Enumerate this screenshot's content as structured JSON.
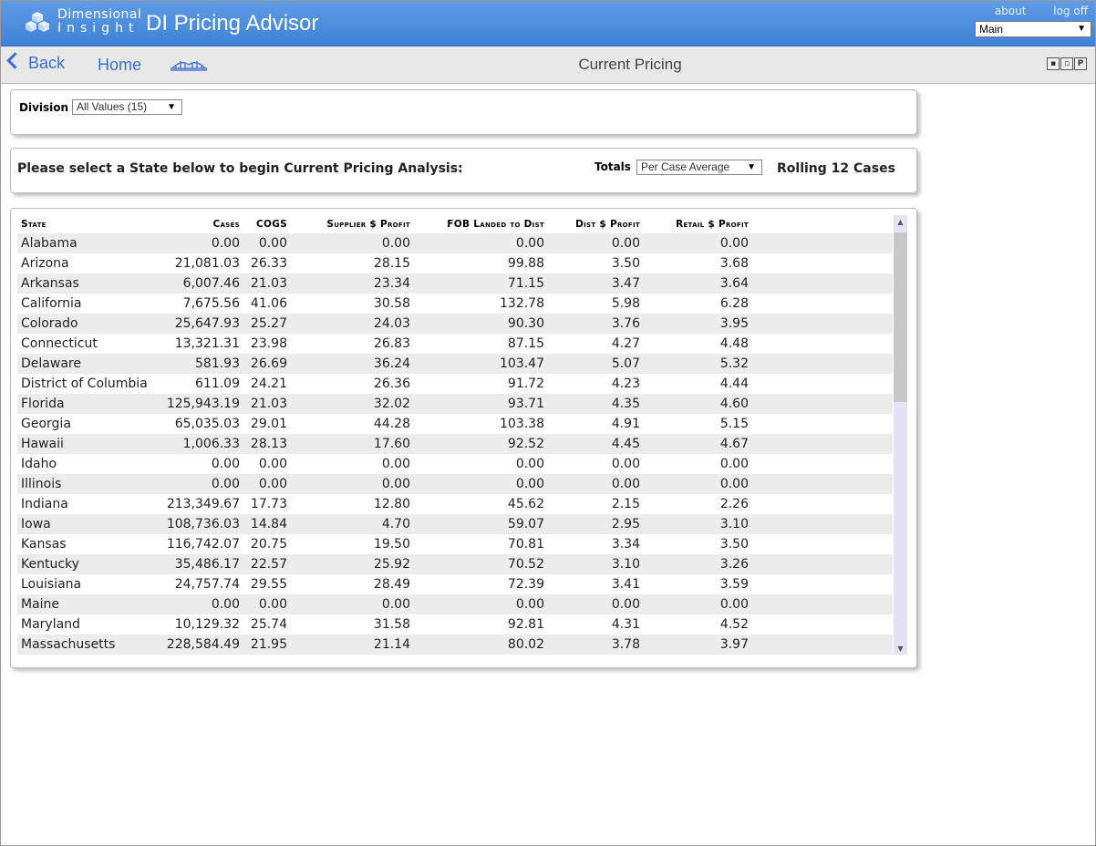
{
  "header": {
    "logo_line1": "Dimensional",
    "logo_line2": "Insight",
    "app_title": "DI Pricing Advisor",
    "about_link": "about",
    "logoff_link": "log off",
    "view_select": "Main"
  },
  "nav": {
    "back_label": "Back",
    "home_label": "Home",
    "page_title": "Current Pricing",
    "icons": [
      "print-icon",
      "export-icon",
      "pdf-icon"
    ],
    "pdf_glyph": "P"
  },
  "filters": {
    "division_label": "Division",
    "division_value": "All Values (15)",
    "prompt": "Please select a State below to begin Current Pricing Analysis:",
    "totals_label": "Totals",
    "totals_value": "Per Case Average",
    "rolling_label": "Rolling 12 Cases"
  },
  "table": {
    "columns": [
      "State",
      "Cases",
      "COGS",
      "Supplier $ Profit",
      "FOB Landed to Dist",
      "Dist $ Profit",
      "Retail $ Profit"
    ],
    "rows": [
      [
        "Alabama",
        "0.00",
        "0.00",
        "0.00",
        "0.00",
        "0.00",
        "0.00"
      ],
      [
        "Arizona",
        "21,081.03",
        "26.33",
        "28.15",
        "99.88",
        "3.50",
        "3.68"
      ],
      [
        "Arkansas",
        "6,007.46",
        "21.03",
        "23.34",
        "71.15",
        "3.47",
        "3.64"
      ],
      [
        "California",
        "7,675.56",
        "41.06",
        "30.58",
        "132.78",
        "5.98",
        "6.28"
      ],
      [
        "Colorado",
        "25,647.93",
        "25.27",
        "24.03",
        "90.30",
        "3.76",
        "3.95"
      ],
      [
        "Connecticut",
        "13,321.31",
        "23.98",
        "26.83",
        "87.15",
        "4.27",
        "4.48"
      ],
      [
        "Delaware",
        "581.93",
        "26.69",
        "36.24",
        "103.47",
        "5.07",
        "5.32"
      ],
      [
        "District of Columbia",
        "611.09",
        "24.21",
        "26.36",
        "91.72",
        "4.23",
        "4.44"
      ],
      [
        "Florida",
        "125,943.19",
        "21.03",
        "32.02",
        "93.71",
        "4.35",
        "4.60"
      ],
      [
        "Georgia",
        "65,035.03",
        "29.01",
        "44.28",
        "103.38",
        "4.91",
        "5.15"
      ],
      [
        "Hawaii",
        "1,006.33",
        "28.13",
        "17.60",
        "92.52",
        "4.45",
        "4.67"
      ],
      [
        "Idaho",
        "0.00",
        "0.00",
        "0.00",
        "0.00",
        "0.00",
        "0.00"
      ],
      [
        "Illinois",
        "0.00",
        "0.00",
        "0.00",
        "0.00",
        "0.00",
        "0.00"
      ],
      [
        "Indiana",
        "213,349.67",
        "17.73",
        "12.80",
        "45.62",
        "2.15",
        "2.26"
      ],
      [
        "Iowa",
        "108,736.03",
        "14.84",
        "4.70",
        "59.07",
        "2.95",
        "3.10"
      ],
      [
        "Kansas",
        "116,742.07",
        "20.75",
        "19.50",
        "70.81",
        "3.34",
        "3.50"
      ],
      [
        "Kentucky",
        "35,486.17",
        "22.57",
        "25.92",
        "70.52",
        "3.10",
        "3.26"
      ],
      [
        "Louisiana",
        "24,757.74",
        "29.55",
        "28.49",
        "72.39",
        "3.41",
        "3.59"
      ],
      [
        "Maine",
        "0.00",
        "0.00",
        "0.00",
        "0.00",
        "0.00",
        "0.00"
      ],
      [
        "Maryland",
        "10,129.32",
        "25.74",
        "31.58",
        "92.81",
        "4.31",
        "4.52"
      ],
      [
        "Massachusetts",
        "228,584.49",
        "21.95",
        "21.14",
        "80.02",
        "3.78",
        "3.97"
      ]
    ]
  },
  "colors": {
    "header_blue": "#4a8ddf",
    "link_blue": "#3a6fd0",
    "row_stripe": "#ececec",
    "scrollbar_track": "#e6e2f6"
  }
}
